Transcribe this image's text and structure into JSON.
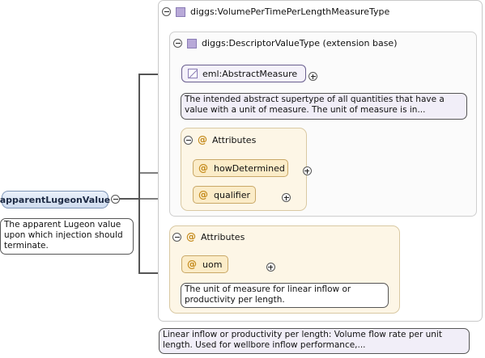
{
  "root_element": {
    "name": "apparentLugeonValue",
    "documentation": "The apparent Lugeon value upon which injection should terminate."
  },
  "complex_type": {
    "name": "diggs:VolumePerTimePerLengthMeasureType",
    "documentation": "Linear inflow or productivity per length: Volume flow rate per unit length. Used for wellbore inflow performance,..."
  },
  "base_type": {
    "name": "diggs:DescriptorValueType (extension base)",
    "abstract_element": {
      "name": "eml:AbstractMeasure",
      "documentation": "The intended abstract supertype of all quantities that have a value with a unit of measure. The unit of measure is in..."
    },
    "attributes": {
      "label": "Attributes",
      "items": [
        {
          "name": "howDetermined"
        },
        {
          "name": "qualifier"
        }
      ]
    }
  },
  "extension_attributes": {
    "label": "Attributes",
    "items": [
      {
        "name": "uom",
        "documentation": "The unit of measure for linear inflow or productivity per length."
      }
    ]
  },
  "icons": {
    "collapse": "minus-circle-icon",
    "expand": "plus-circle-icon",
    "type": "complex-type-square-icon",
    "abstract": "abstract-element-icon",
    "attribute": "at-sign-icon"
  },
  "colors": {
    "type_square": "#b8a9d8",
    "attribute_fill": "#fbecc8",
    "attribute_group": "#fdf6e6",
    "element_fill": "#cfdcef",
    "documentation_fill": "#f1eef8"
  }
}
